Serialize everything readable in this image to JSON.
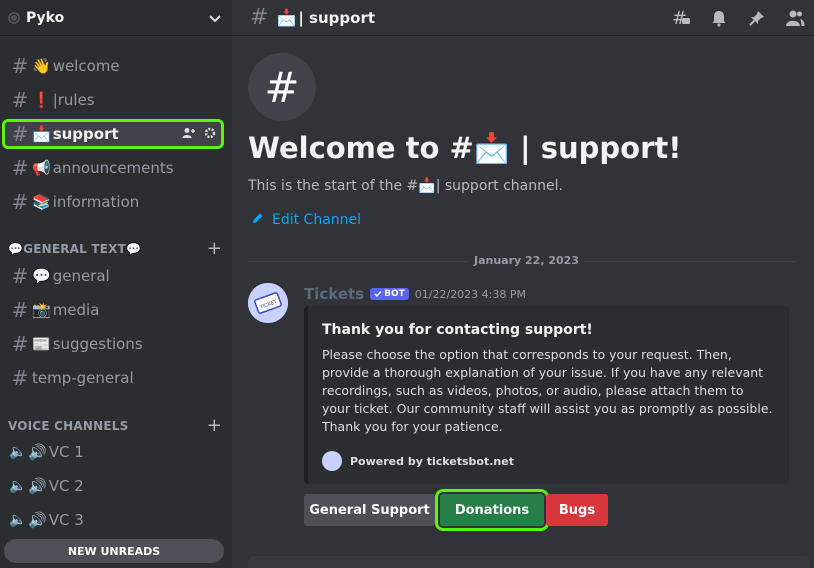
{
  "server": {
    "name": "Pyko"
  },
  "channels": [
    {
      "name": "welcome",
      "emoji": "👋"
    },
    {
      "name": "|rules",
      "emoji": "❗"
    },
    {
      "name": "support",
      "emoji": "📩"
    },
    {
      "name": "announcements",
      "emoji": "📢"
    },
    {
      "name": "information",
      "emoji": "📚"
    }
  ],
  "categories": {
    "general_text": "💬GENERAL TEXT💬",
    "voice": "VOICE CHANNELS"
  },
  "text_channels": [
    {
      "name": "general",
      "emoji": "💬"
    },
    {
      "name": "media",
      "emoji": "📸"
    },
    {
      "name": "suggestions",
      "emoji": "📰"
    },
    {
      "name": "temp-general",
      "emoji": ""
    }
  ],
  "voice_channels": [
    {
      "name": "VC 1",
      "emoji": "🔊"
    },
    {
      "name": "VC 2",
      "emoji": "🔊"
    },
    {
      "name": "VC 3",
      "emoji": "🔊"
    }
  ],
  "unread_pill": "NEW UNREADS",
  "topbar": {
    "emoji": "📩",
    "title": "| support"
  },
  "welcome": {
    "title": "Welcome to #📩 | support!",
    "subtitle": "This is the start of the #📩| support channel.",
    "edit_channel": "Edit Channel"
  },
  "date_divider": "January 22, 2023",
  "message": {
    "author": "Tickets",
    "badge": "BOT",
    "timestamp": "01/22/2023 4:38 PM",
    "embed_title": "Thank you for contacting support!",
    "embed_description": "Please choose the option that corresponds to your request. Then, provide a thorough explanation of your issue. If you have any relevant recordings, such as videos, photos, or audio, please attach them to your ticket. Our community staff will assist you as promptly as possible. Thank you for your patience.",
    "embed_footer": "Powered by ticketsbot.net"
  },
  "buttons": {
    "general": "General Support",
    "donations": "Donations",
    "bugs": "Bugs"
  },
  "colors": {
    "highlight": "#5bf40c",
    "donations": "#248046",
    "bugs": "#da373c",
    "link": "#00a8fc"
  }
}
